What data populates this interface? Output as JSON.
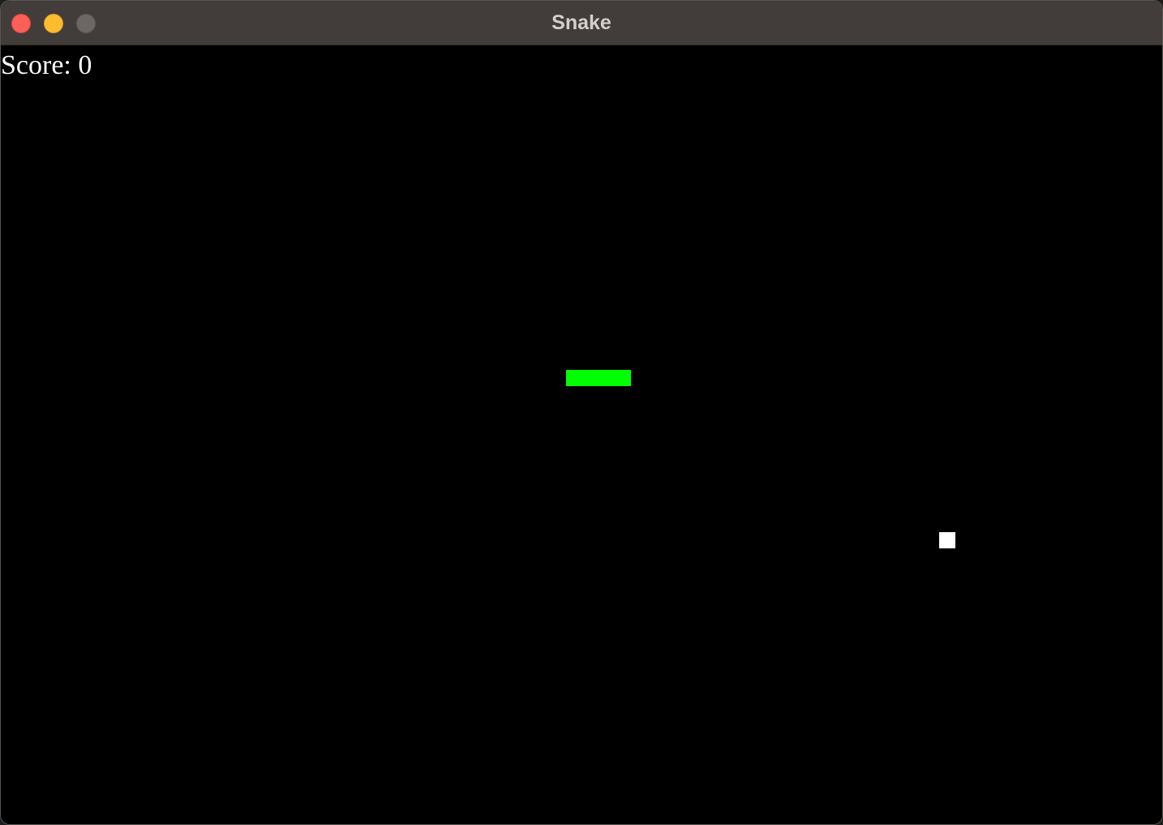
{
  "window": {
    "title": "Snake"
  },
  "hud": {
    "score_text": "Score: 0",
    "score": 0
  },
  "game": {
    "grid_cell_size_note": "",
    "snake": {
      "color": "#00ff00",
      "segments": [
        {
          "col": 35,
          "row": 20
        },
        {
          "col": 36,
          "row": 20
        },
        {
          "col": 37,
          "row": 20
        },
        {
          "col": 38,
          "row": 20
        }
      ]
    },
    "food": {
      "color": "#ffffff",
      "col": 58,
      "row": 30
    }
  },
  "colors": {
    "background": "#000000",
    "titlebar": "#423d3a",
    "close": "#fe5f57",
    "minimize": "#febc2e",
    "zoom_disabled": "#6b6764"
  }
}
